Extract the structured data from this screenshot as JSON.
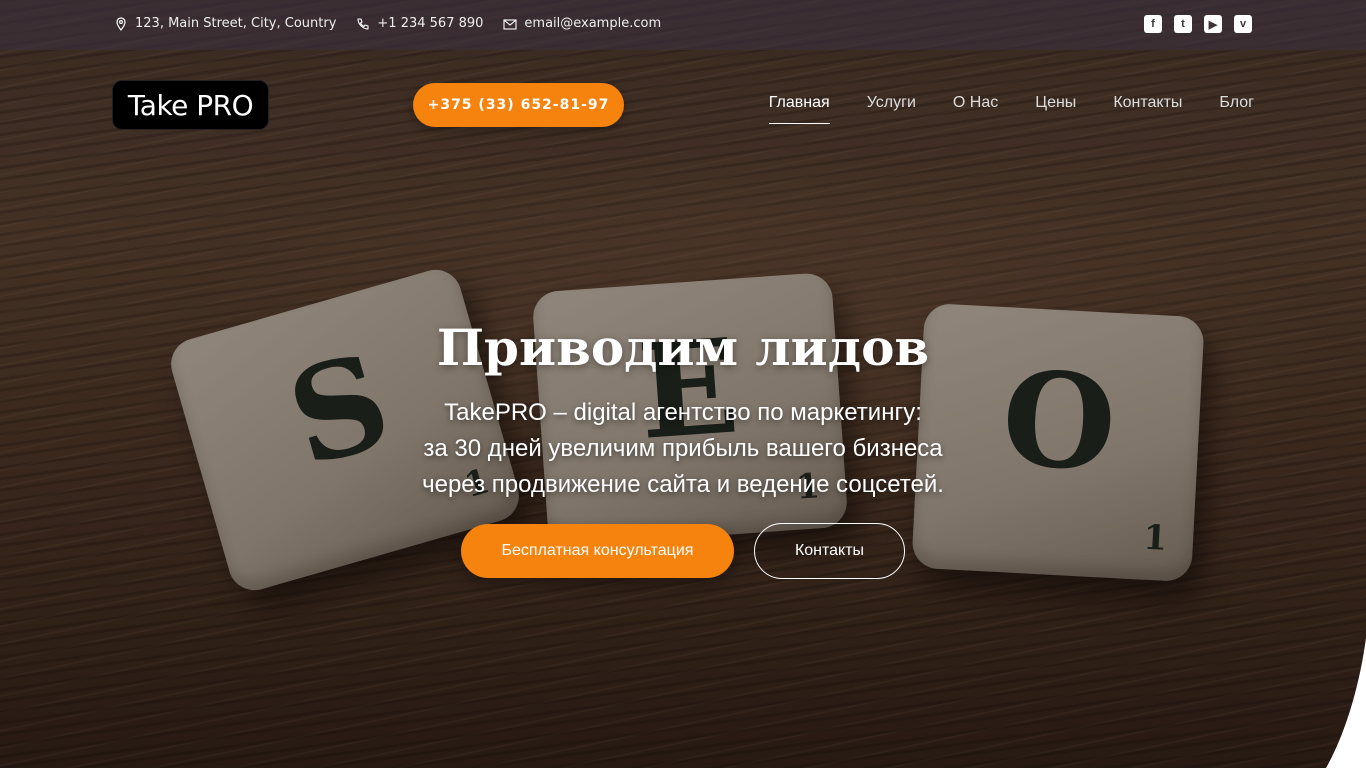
{
  "topbar": {
    "address": "123, Main Street, City, Country",
    "phone": "+1 234 567 890",
    "email": "email@example.com",
    "social": [
      {
        "icon": "facebook-icon",
        "glyph": "f"
      },
      {
        "icon": "twitter-icon",
        "glyph": "t"
      },
      {
        "icon": "youtube-icon",
        "glyph": "▶"
      },
      {
        "icon": "vimeo-icon",
        "glyph": "v"
      }
    ]
  },
  "header": {
    "logo_text": "Take PRO",
    "phone_button": "+375 (33) 652-81-97",
    "nav": [
      {
        "label": "Главная",
        "active": true
      },
      {
        "label": "Услуги",
        "active": false
      },
      {
        "label": "О Нас",
        "active": false
      },
      {
        "label": "Цены",
        "active": false
      },
      {
        "label": "Контакты",
        "active": false
      },
      {
        "label": "Блог",
        "active": false
      }
    ]
  },
  "hero": {
    "title": "Приводим лидов",
    "lines": [
      "TakePRO – digital агентство по маркетингу:",
      "за 30 дней увеличим прибыль вашего бизнеса",
      "через продвижение сайта и ведение соцсетей."
    ],
    "primary_button": "Бесплатная консультация",
    "secondary_button": "Контакты"
  },
  "background": {
    "tiles": [
      {
        "letter": "S",
        "points": "1"
      },
      {
        "letter": "E",
        "points": "1"
      },
      {
        "letter": "O",
        "points": "1"
      }
    ]
  },
  "colors": {
    "accent": "#f5830e",
    "topbar": "#3c3241"
  }
}
